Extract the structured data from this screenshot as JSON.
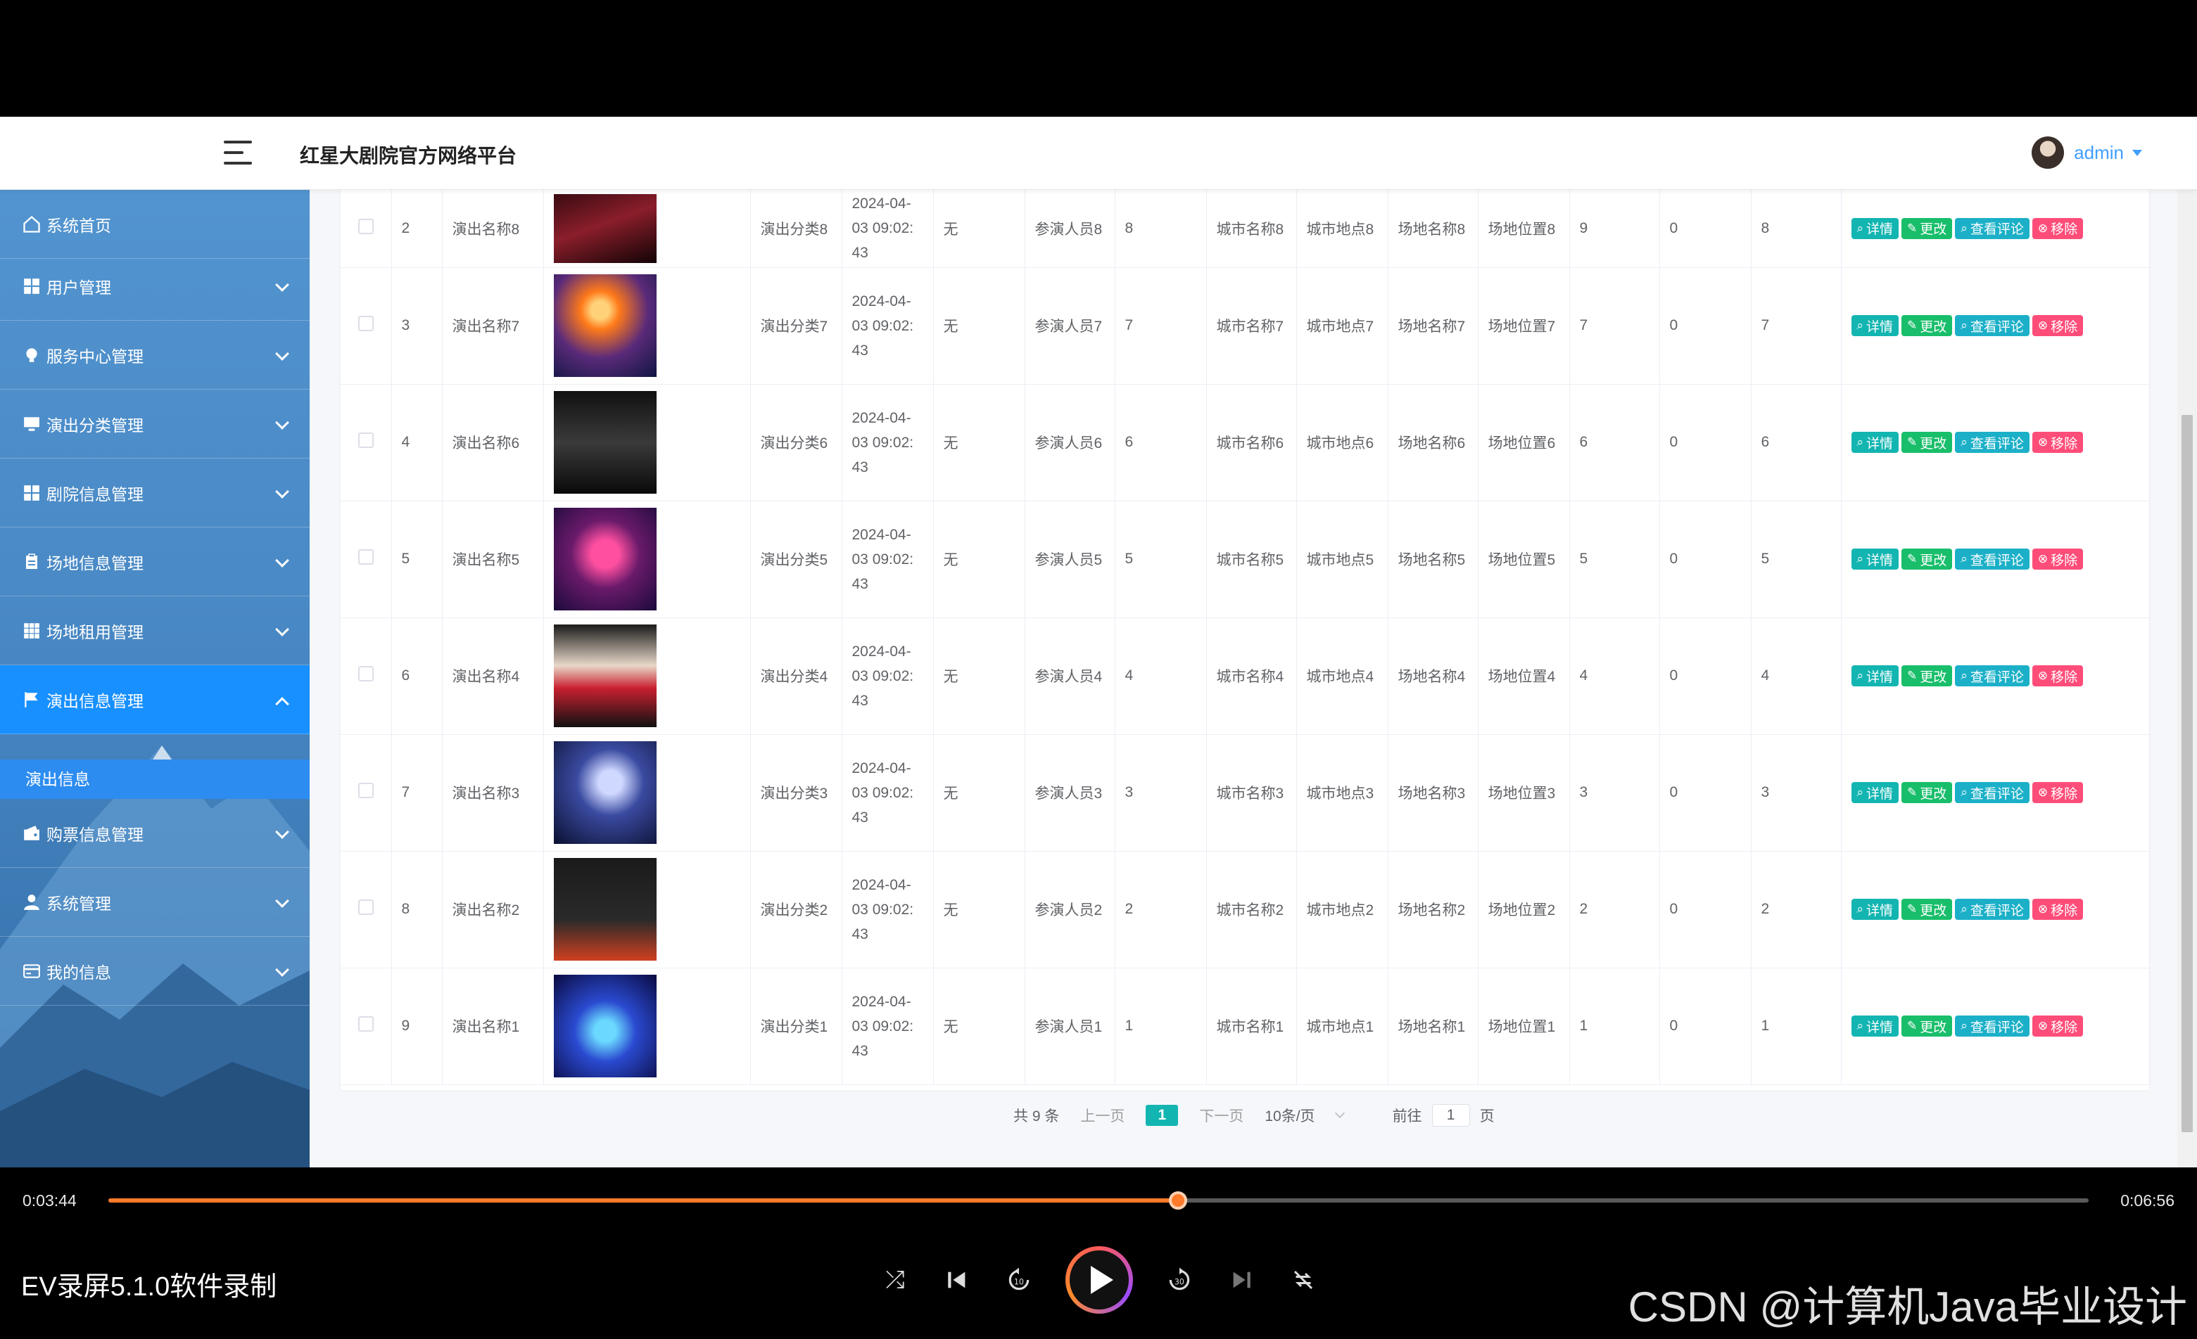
{
  "header": {
    "title": "红星大剧院官方网络平台",
    "user": "admin"
  },
  "sidebar": {
    "items": [
      {
        "label": "系统首页",
        "icon": "home-icon"
      },
      {
        "label": "用户管理",
        "icon": "grid-icon"
      },
      {
        "label": "服务中心管理",
        "icon": "bulb-icon"
      },
      {
        "label": "演出分类管理",
        "icon": "monitor-icon"
      },
      {
        "label": "剧院信息管理",
        "icon": "grid-icon"
      },
      {
        "label": "场地信息管理",
        "icon": "clipboard-icon"
      },
      {
        "label": "场地租用管理",
        "icon": "apps-icon"
      },
      {
        "label": "演出信息管理",
        "icon": "flag-icon"
      },
      {
        "label": "购票信息管理",
        "icon": "wallet-icon"
      },
      {
        "label": "系统管理",
        "icon": "user-icon"
      },
      {
        "label": "我的信息",
        "icon": "card-icon"
      }
    ],
    "submenu": "演出信息"
  },
  "table": {
    "rows": [
      {
        "id": "2",
        "name": "演出名称8",
        "category": "演出分类8",
        "time": [
          "2024-04-",
          "03 09:02:",
          "43"
        ],
        "note": "无",
        "performer": "参演人员8",
        "n1": "8",
        "city": "城市名称8",
        "addr": "城市地点8",
        "venue": "场地名称8",
        "pos": "场地位置8",
        "n2": "9",
        "n3": "0",
        "n4": "8"
      },
      {
        "id": "3",
        "name": "演出名称7",
        "category": "演出分类7",
        "time": [
          "2024-04-",
          "03 09:02:",
          "43"
        ],
        "note": "无",
        "performer": "参演人员7",
        "n1": "7",
        "city": "城市名称7",
        "addr": "城市地点7",
        "venue": "场地名称7",
        "pos": "场地位置7",
        "n2": "7",
        "n3": "0",
        "n4": "7"
      },
      {
        "id": "4",
        "name": "演出名称6",
        "category": "演出分类6",
        "time": [
          "2024-04-",
          "03 09:02:",
          "43"
        ],
        "note": "无",
        "performer": "参演人员6",
        "n1": "6",
        "city": "城市名称6",
        "addr": "城市地点6",
        "venue": "场地名称6",
        "pos": "场地位置6",
        "n2": "6",
        "n3": "0",
        "n4": "6"
      },
      {
        "id": "5",
        "name": "演出名称5",
        "category": "演出分类5",
        "time": [
          "2024-04-",
          "03 09:02:",
          "43"
        ],
        "note": "无",
        "performer": "参演人员5",
        "n1": "5",
        "city": "城市名称5",
        "addr": "城市地点5",
        "venue": "场地名称5",
        "pos": "场地位置5",
        "n2": "5",
        "n3": "0",
        "n4": "5"
      },
      {
        "id": "6",
        "name": "演出名称4",
        "category": "演出分类4",
        "time": [
          "2024-04-",
          "03 09:02:",
          "43"
        ],
        "note": "无",
        "performer": "参演人员4",
        "n1": "4",
        "city": "城市名称4",
        "addr": "城市地点4",
        "venue": "场地名称4",
        "pos": "场地位置4",
        "n2": "4",
        "n3": "0",
        "n4": "4"
      },
      {
        "id": "7",
        "name": "演出名称3",
        "category": "演出分类3",
        "time": [
          "2024-04-",
          "03 09:02:",
          "43"
        ],
        "note": "无",
        "performer": "参演人员3",
        "n1": "3",
        "city": "城市名称3",
        "addr": "城市地点3",
        "venue": "场地名称3",
        "pos": "场地位置3",
        "n2": "3",
        "n3": "0",
        "n4": "3"
      },
      {
        "id": "8",
        "name": "演出名称2",
        "category": "演出分类2",
        "time": [
          "2024-04-",
          "03 09:02:",
          "43"
        ],
        "note": "无",
        "performer": "参演人员2",
        "n1": "2",
        "city": "城市名称2",
        "addr": "城市地点2",
        "venue": "场地名称2",
        "pos": "场地位置2",
        "n2": "2",
        "n3": "0",
        "n4": "2"
      },
      {
        "id": "9",
        "name": "演出名称1",
        "category": "演出分类1",
        "time": [
          "2024-04-",
          "03 09:02:",
          "43"
        ],
        "note": "无",
        "performer": "参演人员1",
        "n1": "1",
        "city": "城市名称1",
        "addr": "城市地点1",
        "venue": "场地名称1",
        "pos": "场地位置1",
        "n2": "1",
        "n3": "0",
        "n4": "1"
      }
    ],
    "actions": {
      "detail": "详情",
      "edit": "更改",
      "review": "查看评论",
      "remove": "移除"
    }
  },
  "pagination": {
    "total": "共 9 条",
    "prev": "上一页",
    "current": "1",
    "next": "下一页",
    "page_size": "10条/页",
    "goto": "前往",
    "goto_value": "1",
    "page_unit": "页"
  },
  "player": {
    "current_time": "0:03:44",
    "total_time": "0:06:56",
    "progress": 0.54,
    "recorder_label": "EV录屏5.1.0软件录制",
    "watermark": "CSDN @计算机Java毕业设计"
  }
}
